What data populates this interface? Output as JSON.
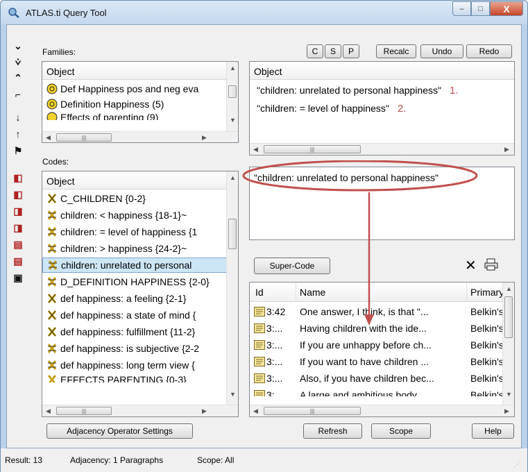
{
  "window": {
    "title": "ATLAS.ti Query Tool",
    "minimize_glyph": "–",
    "maximize_glyph": "□",
    "close_glyph": "X"
  },
  "toolbar": {
    "c_label": "C",
    "s_label": "S",
    "p_label": "P",
    "recalc_label": "Recalc",
    "undo_label": "Undo",
    "redo_label": "Redo"
  },
  "families": {
    "label": "Families:",
    "header": "Object",
    "items": [
      "Def Happiness pos and neg eva",
      "Definition Happiness (5)",
      "Effects of parenting (9)"
    ]
  },
  "codes": {
    "label": "Codes:",
    "header": "Object",
    "items": [
      "C_CHILDREN {0-2}",
      "children: < happiness {18-1}~",
      "children: = level of happiness {1",
      "children: > happiness {24-2}~",
      "children: unrelated to personal",
      "D_DEFINITION HAPPINESS {2-0}",
      "def happiness: a feeling {2-1}",
      "def happiness: a state of mind {",
      "def happiness: fulfillment {11-2}",
      "def happiness: is subjective {2-2",
      "def happiness: long term view {",
      "EFFECTS PARENTING {0-3}"
    ]
  },
  "terms": {
    "header": "Object",
    "items": [
      {
        "text": "\"children: unrelated to personal happiness\"",
        "number": "1."
      },
      {
        "text": "\"children: = level of happiness\"",
        "number": "2."
      }
    ]
  },
  "query_text": "\"children: unrelated to personal happiness\"",
  "supercode_label": "Super-Code",
  "results": {
    "columns": [
      "Id",
      "Name",
      "Primary"
    ],
    "rows": [
      {
        "id": "3:42",
        "name": "One answer, I think, is that \"...",
        "primary": "Belkin's"
      },
      {
        "id": "3:...",
        "name": "Having children with the ide...",
        "primary": "Belkin's"
      },
      {
        "id": "3:...",
        "name": "If you are unhappy before ch...",
        "primary": "Belkin's"
      },
      {
        "id": "3:...",
        "name": "If you want to have children ...",
        "primary": "Belkin's"
      },
      {
        "id": "3:...",
        "name": "Also, if you have children bec...",
        "primary": "Belkin's"
      },
      {
        "id": "3:...",
        "name": "A large and ambitious body ...",
        "primary": "Belkin's"
      }
    ]
  },
  "buttons": {
    "adjacency": "Adjacency Operator Settings",
    "refresh": "Refresh",
    "scope": "Scope",
    "help": "Help"
  },
  "status": {
    "result": "Result: 13",
    "adjacency": "Adjacency: 1 Paragraphs",
    "scope": "Scope: All"
  },
  "colors": {
    "annotation_red": "#c0504d",
    "selection": "#cde6f7",
    "window_frame": "#b9d1ea"
  }
}
